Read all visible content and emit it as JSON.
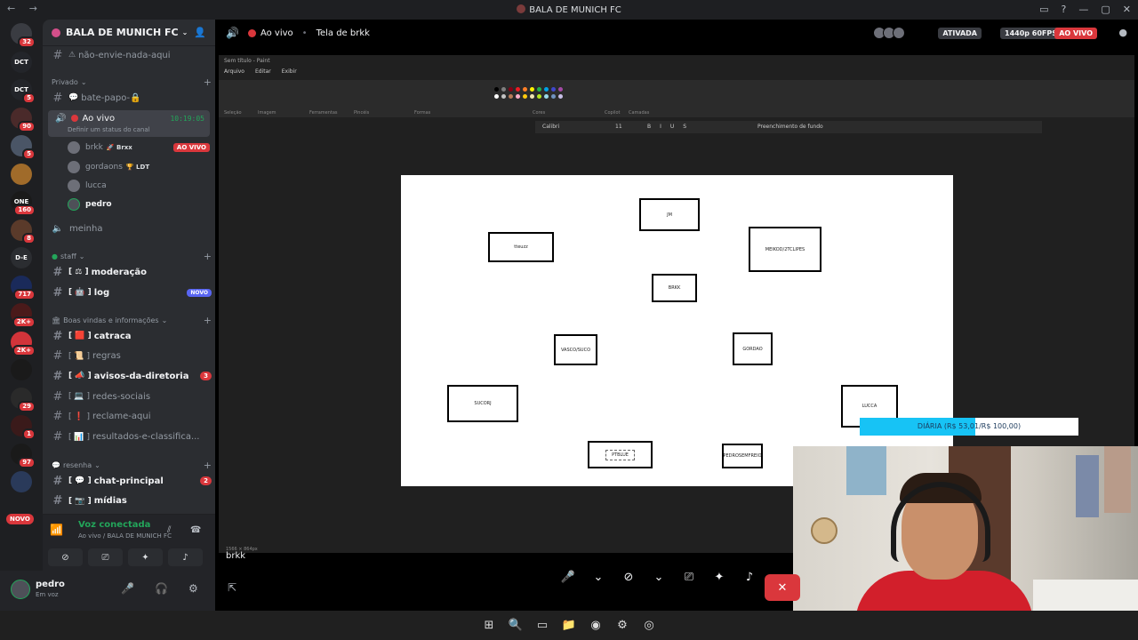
{
  "window": {
    "title": "BALA DE MUNICH FC",
    "nav_arrows": "← →"
  },
  "rail": {
    "servers": [
      {
        "label": "",
        "badge": "32",
        "color": "#3a3c42"
      },
      {
        "label": "DCT",
        "badge": "",
        "color": "#23252a"
      },
      {
        "label": "DCT",
        "badge": "5",
        "color": "#23252a"
      },
      {
        "label": "",
        "badge": "90",
        "color": "#4a2a2a"
      },
      {
        "label": "",
        "badge": "5",
        "color": "#4a5566"
      },
      {
        "label": "",
        "badge": "",
        "color": "#a06b2a"
      },
      {
        "label": "ONE",
        "badge": "160",
        "color": "#1a1a1a"
      },
      {
        "label": "",
        "badge": "8",
        "color": "#5a3a2a"
      },
      {
        "label": "D-E",
        "badge": "",
        "color": "#2b2d31"
      },
      {
        "label": "",
        "badge": "717",
        "color": "#1a2a5a"
      },
      {
        "label": "",
        "badge": "2K+",
        "color": "#4a1a1a"
      },
      {
        "label": "",
        "badge": "2K+",
        "color": "#d2343a"
      },
      {
        "label": "",
        "badge": "",
        "color": "#1a1a1a"
      },
      {
        "label": "",
        "badge": "29",
        "color": "#2a2a2a"
      },
      {
        "label": "",
        "badge": "1",
        "color": "#3a1a1a"
      },
      {
        "label": "",
        "badge": "97",
        "color": "#1a1a1a"
      },
      {
        "label": "",
        "badge": "",
        "color": "#2a3a5a"
      }
    ],
    "novo": "NOVO"
  },
  "sidebar": {
    "guild_name": "BALA DE MUNICH FC",
    "channels_top": [
      {
        "name": "não-envie-nada-aqui",
        "emoji": "⚠"
      }
    ],
    "cat_privado": "Privado",
    "bate_papo": "bate-papo-🔒",
    "voice_channel": {
      "name": "Ao vivo",
      "time": "10:19:05",
      "status": "Definir um status do canal"
    },
    "voice_users": [
      {
        "name": "brkk",
        "tag": "🚀 Brxx",
        "live": "AO VIVO"
      },
      {
        "name": "gordaons",
        "tag": "🏆 LDT",
        "live": ""
      },
      {
        "name": "lucca",
        "tag": "",
        "live": ""
      },
      {
        "name": "pedro",
        "tag": "",
        "live": ""
      }
    ],
    "meinha": "meinha",
    "cat_staff": "staff",
    "staff_channels": [
      {
        "name": "moderação",
        "emoji": "[ ⚖ ]",
        "badge": ""
      },
      {
        "name": "log",
        "emoji": "[ 🤖 ]",
        "badge": "NOVO"
      }
    ],
    "cat_boas": "Boas vindas e informações",
    "boas_channels": [
      {
        "name": "catraca",
        "emoji": "[ 🟥 ]",
        "badge": "",
        "bright": true
      },
      {
        "name": "regras",
        "emoji": "[ 📜 ]",
        "badge": "",
        "bright": false
      },
      {
        "name": "avisos-da-diretoria",
        "emoji": "[ 📣 ]",
        "badge": "3",
        "bright": true
      },
      {
        "name": "redes-sociais",
        "emoji": "[ 💻 ]",
        "badge": "",
        "bright": false
      },
      {
        "name": "reclame-aqui",
        "emoji": "[ ❗ ]",
        "badge": "",
        "bright": false
      },
      {
        "name": "resultados-e-classifica...",
        "emoji": "[ 📊 ]",
        "badge": "",
        "bright": false
      }
    ],
    "cat_resenha": "resenha",
    "resenha_channels": [
      {
        "name": "chat-principal",
        "emoji": "[ 💬 ]",
        "badge": "2",
        "bright": true
      },
      {
        "name": "mídias",
        "emoji": "[ 📷 ]",
        "badge": "",
        "bright": true
      }
    ]
  },
  "voice_connected": {
    "label": "Voz conectada",
    "sub": "Ao vivo / BALA DE MUNICH FC"
  },
  "user": {
    "name": "pedro",
    "status": "Em voz"
  },
  "stream": {
    "channel": "Ao vivo",
    "screen": "Tela de brkk",
    "ativada": "ATIVADA",
    "quality": "1440p 60FPS",
    "live": "AO VIVO",
    "streamer": "brkk"
  },
  "paint": {
    "title": "Sem título - Paint",
    "menu": [
      "Arquivo",
      "Editar",
      "Exibir"
    ],
    "ribbon_labels": [
      "Seleção",
      "Imagem",
      "Ferramentas",
      "Pincéis",
      "Formas",
      "Cores",
      "Copilot",
      "Camadas"
    ],
    "font_name": "Calibri",
    "font_size": "11",
    "fill_label": "Preenchimento de fundo",
    "status": [
      "1566 × 864px"
    ],
    "boxes": [
      "JM",
      "tteuzz",
      "MEIKOD/2TCLIPES",
      "BRKK",
      "VASCO/SUCO",
      "GORDAO",
      "SUCORJ",
      "LUCCA",
      "PTBLUE",
      "PEDROSEMFREIO"
    ]
  },
  "goal": {
    "text": "DIÁRIA (R$ 53,01/R$ 100,00)",
    "progress": 0.53
  },
  "taskbar": [
    "⊞",
    "🔍",
    "▭",
    "📁",
    "◉",
    "⚙",
    "◎"
  ]
}
